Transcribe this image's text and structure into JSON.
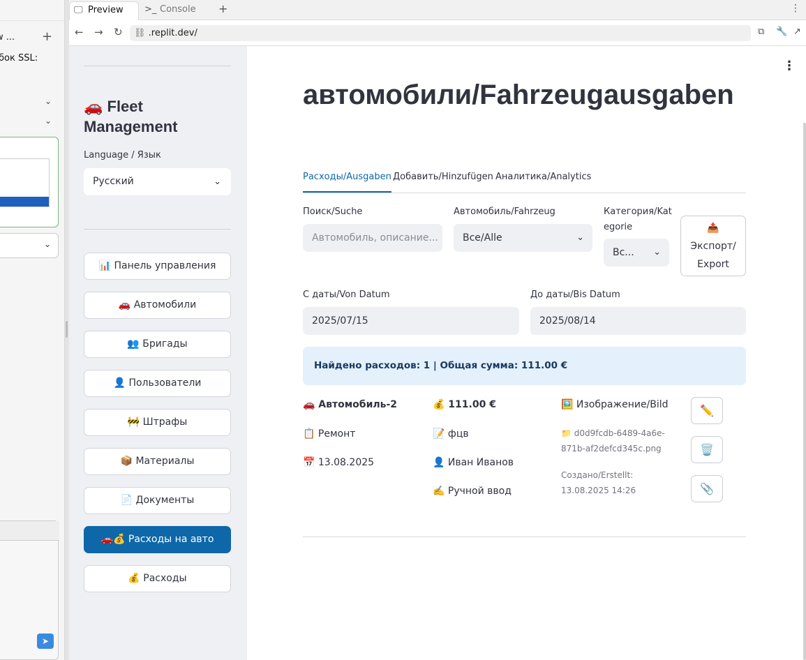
{
  "left_panel": {
    "tab_label": "w ...",
    "ssl_text": "бок SSL:"
  },
  "browser": {
    "tabs": [
      {
        "label": "Preview",
        "icon": "monitor-icon"
      },
      {
        "label": "Console",
        "icon": "terminal-icon"
      }
    ],
    "url": ".replit.dev/"
  },
  "sidebar": {
    "title": "🚗 Fleet Management",
    "language_label": "Language / Язык",
    "language_value": "Русский",
    "nav": [
      {
        "label": "📊 Панель управления"
      },
      {
        "label": "🚗 Автомобили"
      },
      {
        "label": "👥 Бригады"
      },
      {
        "label": "👤 Пользователи"
      },
      {
        "label": "🚧 Штрафы"
      },
      {
        "label": "📦 Материалы"
      },
      {
        "label": "📄 Документы"
      },
      {
        "label": "🚗💰 Расходы на авто",
        "active": true
      },
      {
        "label": "💰 Расходы"
      }
    ]
  },
  "main": {
    "title": "автомобили/Fahrzeugausgaben",
    "tabs": [
      "Расходы/Ausgaben",
      "Добавить/Hinzufügen",
      "Аналитика/Analytics"
    ],
    "filters": {
      "search_label": "Поиск/Suche",
      "search_placeholder": "Автомобиль, описание...",
      "vehicle_label": "Автомобиль/Fahrzeug",
      "vehicle_value": "Все/Alle",
      "category_label_1": "Категория/Kat",
      "category_label_2": "egorie",
      "category_value": "Вс...",
      "export_icon": "📤",
      "export_line1": "Экспорт/",
      "export_line2": "Export",
      "date_from_label": "С даты/Von Datum",
      "date_from_value": "2025/07/15",
      "date_to_label": "До даты/Bis Datum",
      "date_to_value": "2025/08/14"
    },
    "summary": "Найдено расходов: 1 | Общая сумма: 111.00 €",
    "expense": {
      "vehicle": "🚗 Автомобиль-2",
      "category": "📋 Ремонт",
      "date": "📅 13.08.2025",
      "amount": "💰 111.00 €",
      "description": "📝 фцв",
      "user": "👤 Иван Иванов",
      "entry_type": "✍️ Ручной ввод",
      "image_label": "🖼️ Изображение/Bild",
      "file_name": "📁 d0d9fcdb-6489-4a6e-871b-af2defcd345c.png",
      "created": "Создано/Erstellt: 13.08.2025 14:26",
      "actions": [
        {
          "icon": "✏️",
          "name": "edit-icon"
        },
        {
          "icon": "🗑️",
          "name": "trash-icon"
        },
        {
          "icon": "📎",
          "name": "paperclip-icon"
        }
      ]
    }
  }
}
